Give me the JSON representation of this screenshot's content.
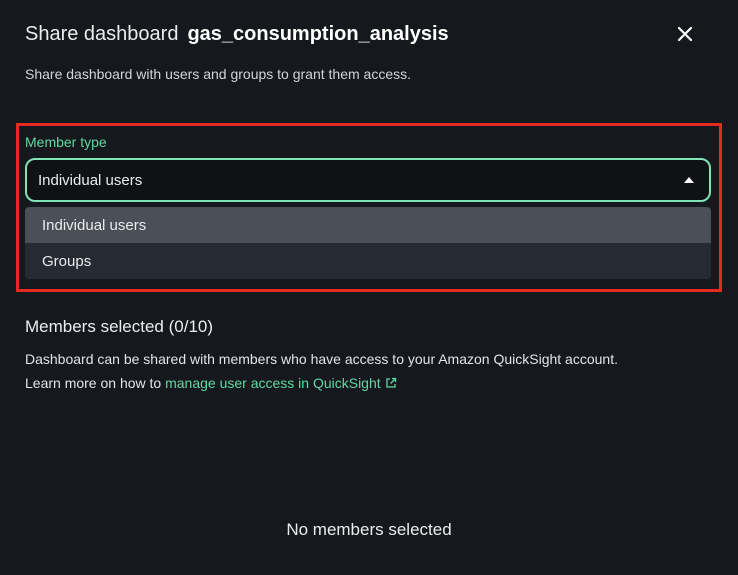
{
  "dialog": {
    "title_prefix": "Share dashboard",
    "title_name": "gas_consumption_analysis",
    "close_icon": "close-icon",
    "subtitle": "Share dashboard with users and groups to grant them access."
  },
  "member_type": {
    "label": "Member type",
    "selected_value": "Individual users",
    "caret_icon": "caret-up-icon",
    "options": [
      {
        "label": "Individual users",
        "selected": true
      },
      {
        "label": "Groups",
        "selected": false
      }
    ]
  },
  "members": {
    "heading": "Members selected (0/10)",
    "description_line1": "Dashboard can be shared with members who have access to your Amazon QuickSight account.",
    "description_line2_prefix": "Learn more on how to ",
    "link_text": "manage user access in QuickSight",
    "link_icon": "external-link-icon",
    "empty_text": "No members selected"
  },
  "colors": {
    "background": "#15181d",
    "accent_green": "#5fd9a3",
    "select_border": "#7fe3b6",
    "highlight_red": "#e8291f"
  }
}
